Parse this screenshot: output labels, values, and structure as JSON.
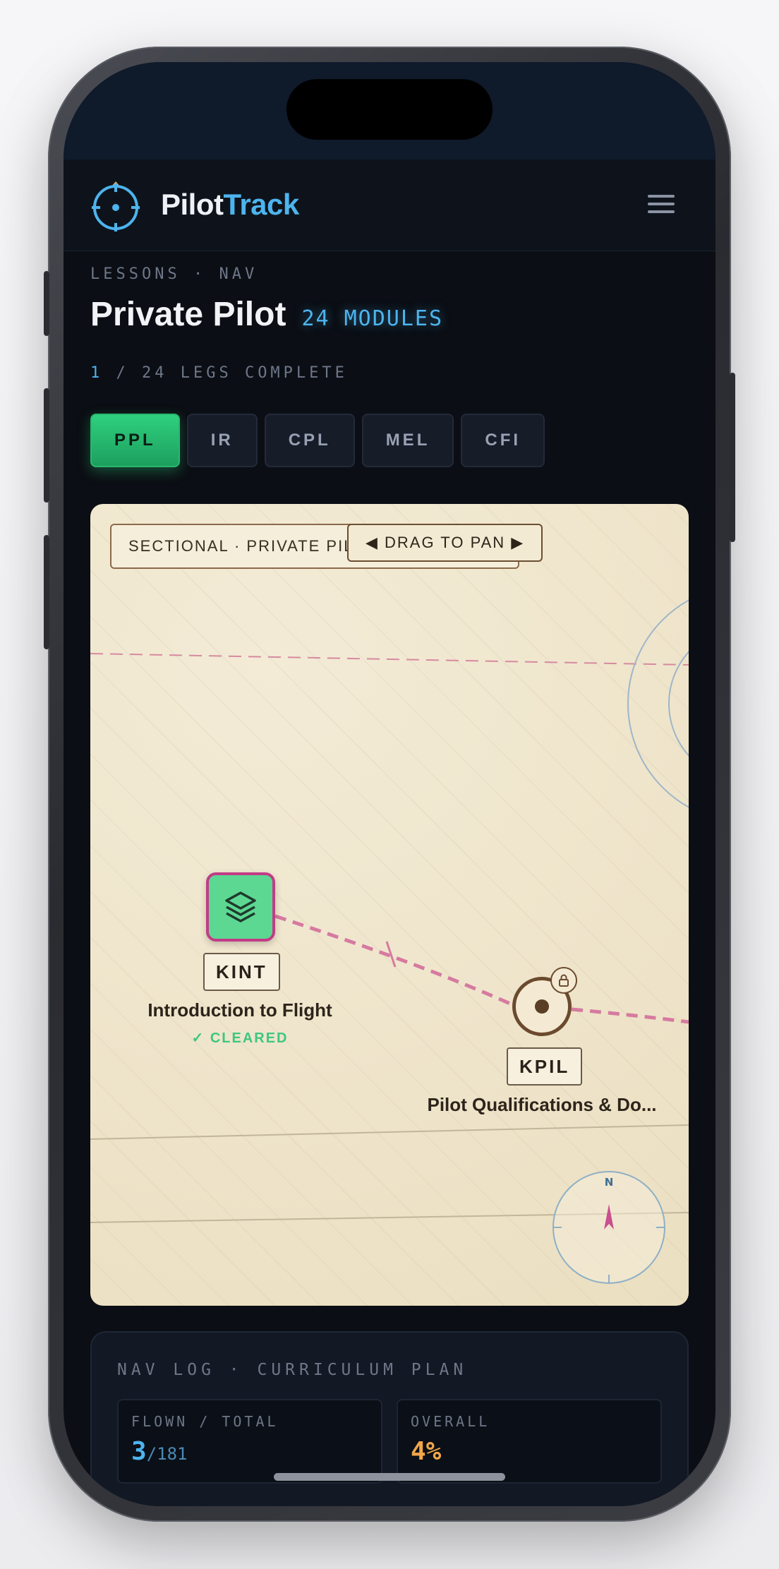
{
  "app": {
    "brand_part1": "Pilot",
    "brand_part2": "Track",
    "accent_color": "#4db4ee",
    "icons": [
      "crosshair-logo-icon",
      "menu-icon",
      "layers-icon",
      "lock-icon",
      "compass-icon"
    ]
  },
  "header": {
    "eyebrow": "LESSONS · NAV",
    "title": "Private Pilot",
    "module_count": "24 MODULES",
    "progress_done": "1",
    "progress_rest": " / 24 LEGS COMPLETE"
  },
  "tabs": [
    {
      "label": "PPL",
      "active": true
    },
    {
      "label": "IR",
      "active": false
    },
    {
      "label": "CPL",
      "active": false
    },
    {
      "label": "MEL",
      "active": false
    },
    {
      "label": "CFI",
      "active": false
    }
  ],
  "map": {
    "chart_label": "SECTIONAL · PRIVATE PILOT · 24 MODULES",
    "pan_hint": "◀ DRAG TO PAN ▶",
    "compass_n": "N",
    "nodes": [
      {
        "ident": "KINT",
        "name": "Introduction to Flight",
        "status": "✓ CLEARED"
      },
      {
        "ident": "KPIL",
        "name": "Pilot Qualifications & Do...",
        "status": "locked"
      }
    ]
  },
  "navlog": {
    "title": "NAV LOG · CURRICULUM PLAN",
    "flown_label": "FLOWN / TOTAL",
    "flown_value": "3",
    "flown_total": "/181",
    "overall_label": "OVERALL",
    "overall_value": "4%",
    "overall_color": "#f0a64a"
  }
}
